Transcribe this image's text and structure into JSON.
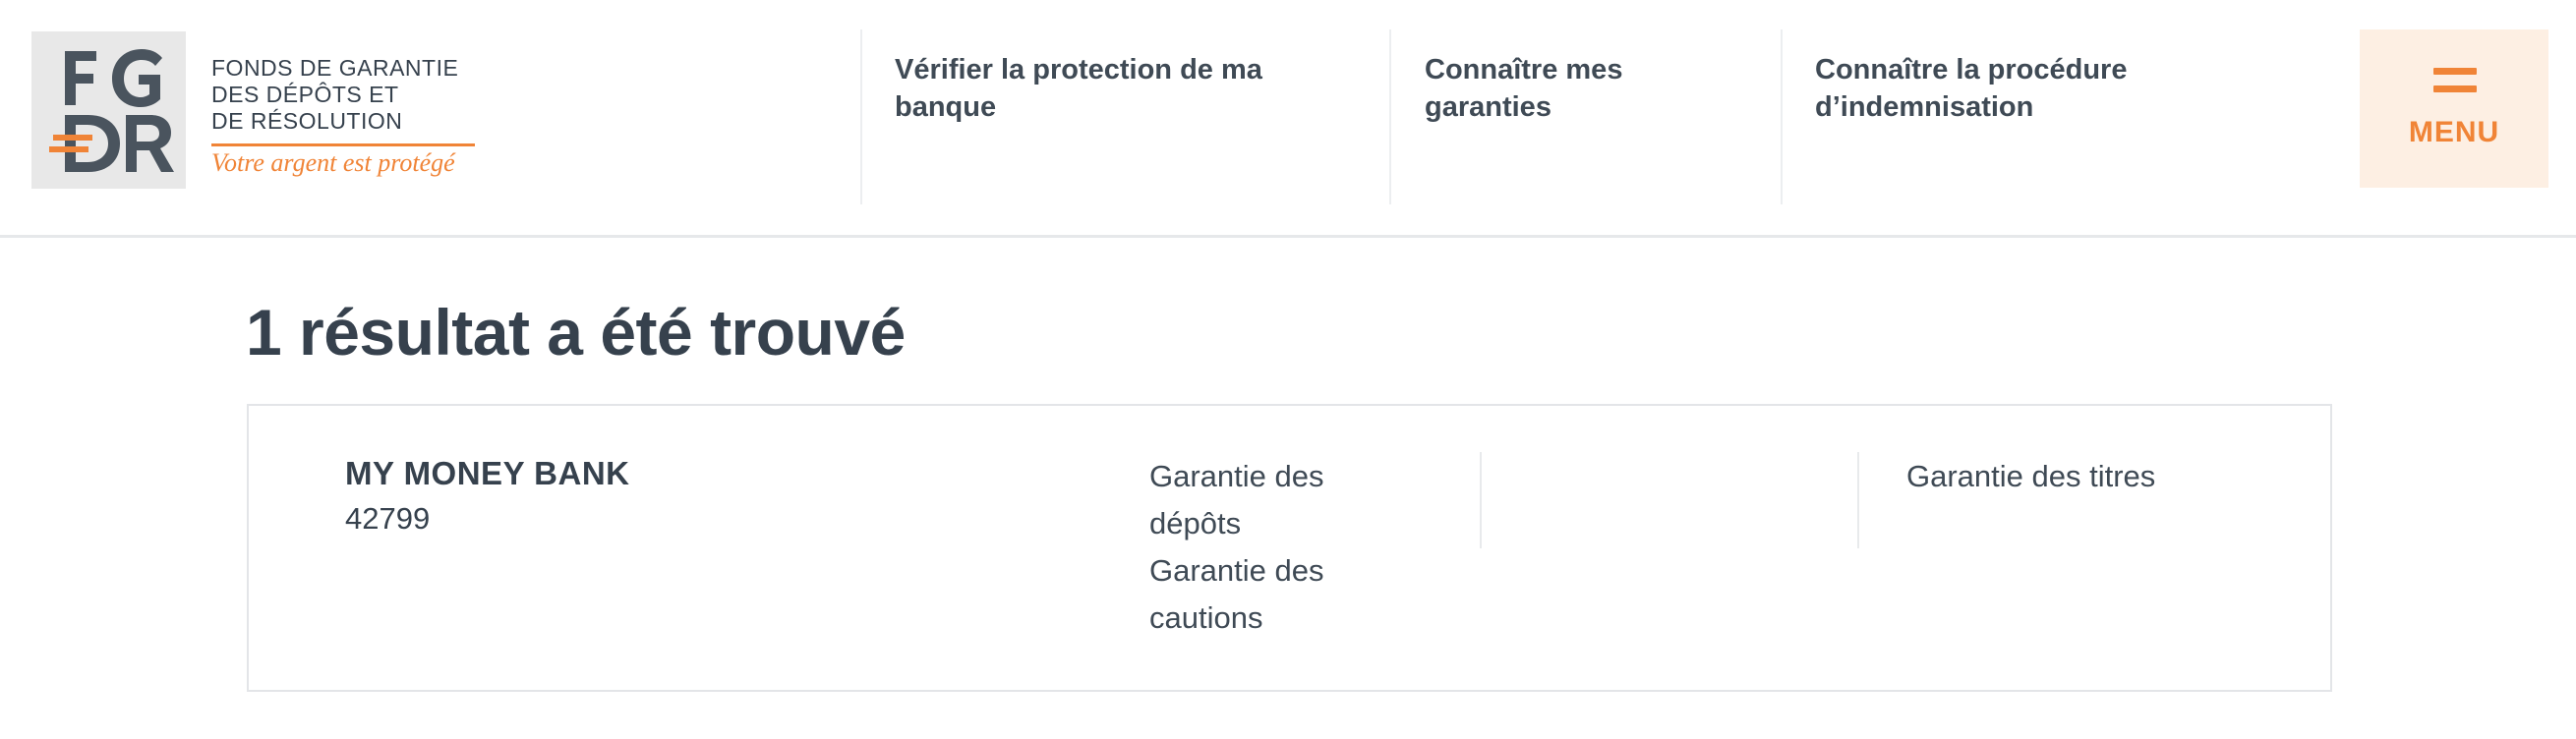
{
  "logo": {
    "mark_text": "FGDR",
    "lines": [
      "FONDS DE GARANTIE",
      "DES DÉPÔTS ET",
      "DE RÉSOLUTION"
    ],
    "tagline": "Votre argent est protégé",
    "brand_color": "#f08437",
    "text_color": "#36414d"
  },
  "nav": {
    "items": [
      {
        "line1": "Vérifier la protection de ma",
        "line2": "banque"
      },
      {
        "line1": "Connaître mes",
        "line2": "garanties"
      },
      {
        "line1": "Connaître la procédure",
        "line2": "d’indemnisation"
      }
    ],
    "menu_label": "MENU",
    "menu_icon": "menu-icon"
  },
  "results": {
    "title": "1 résultat a été trouvé",
    "card": {
      "bank_name": "MY MONEY BANK",
      "bank_code": "42799",
      "guarantees": [
        "Garantie des dépôts",
        "Garantie des cautions"
      ],
      "titres": "Garantie des titres"
    }
  }
}
